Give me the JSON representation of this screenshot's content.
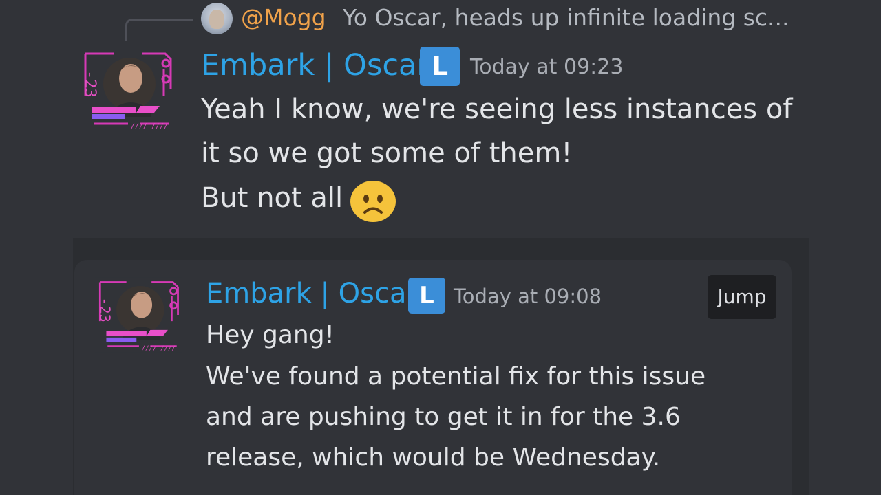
{
  "reply": {
    "author": "@Mogg",
    "preview": "Yo Oscar, heads up infinite loading sc..."
  },
  "message": {
    "author": "Embark | Oscar",
    "badge": "L",
    "timestamp": "Today at 09:23",
    "lines": [
      "Yeah I know, we're seeing less instances of",
      "it so we got some of them!",
      "But not all"
    ],
    "emoji": "frowning-face-emoji"
  },
  "embed": {
    "author": "Embark | Oscar",
    "badge": "L",
    "timestamp": "Today at 09:08",
    "lines": [
      "Hey gang!",
      "We've found a potential fix for this issue",
      "and are pushing to get it in for the 3.6",
      "release, which would be Wednesday."
    ],
    "jump_label": "Jump"
  },
  "colors": {
    "background": "#313338",
    "embed_outer": "#2b2d31",
    "author": "#2ea3e6",
    "reply_author": "#f0a24a",
    "badge": "#3b8ed8",
    "jump_button": "#1e1f22"
  }
}
